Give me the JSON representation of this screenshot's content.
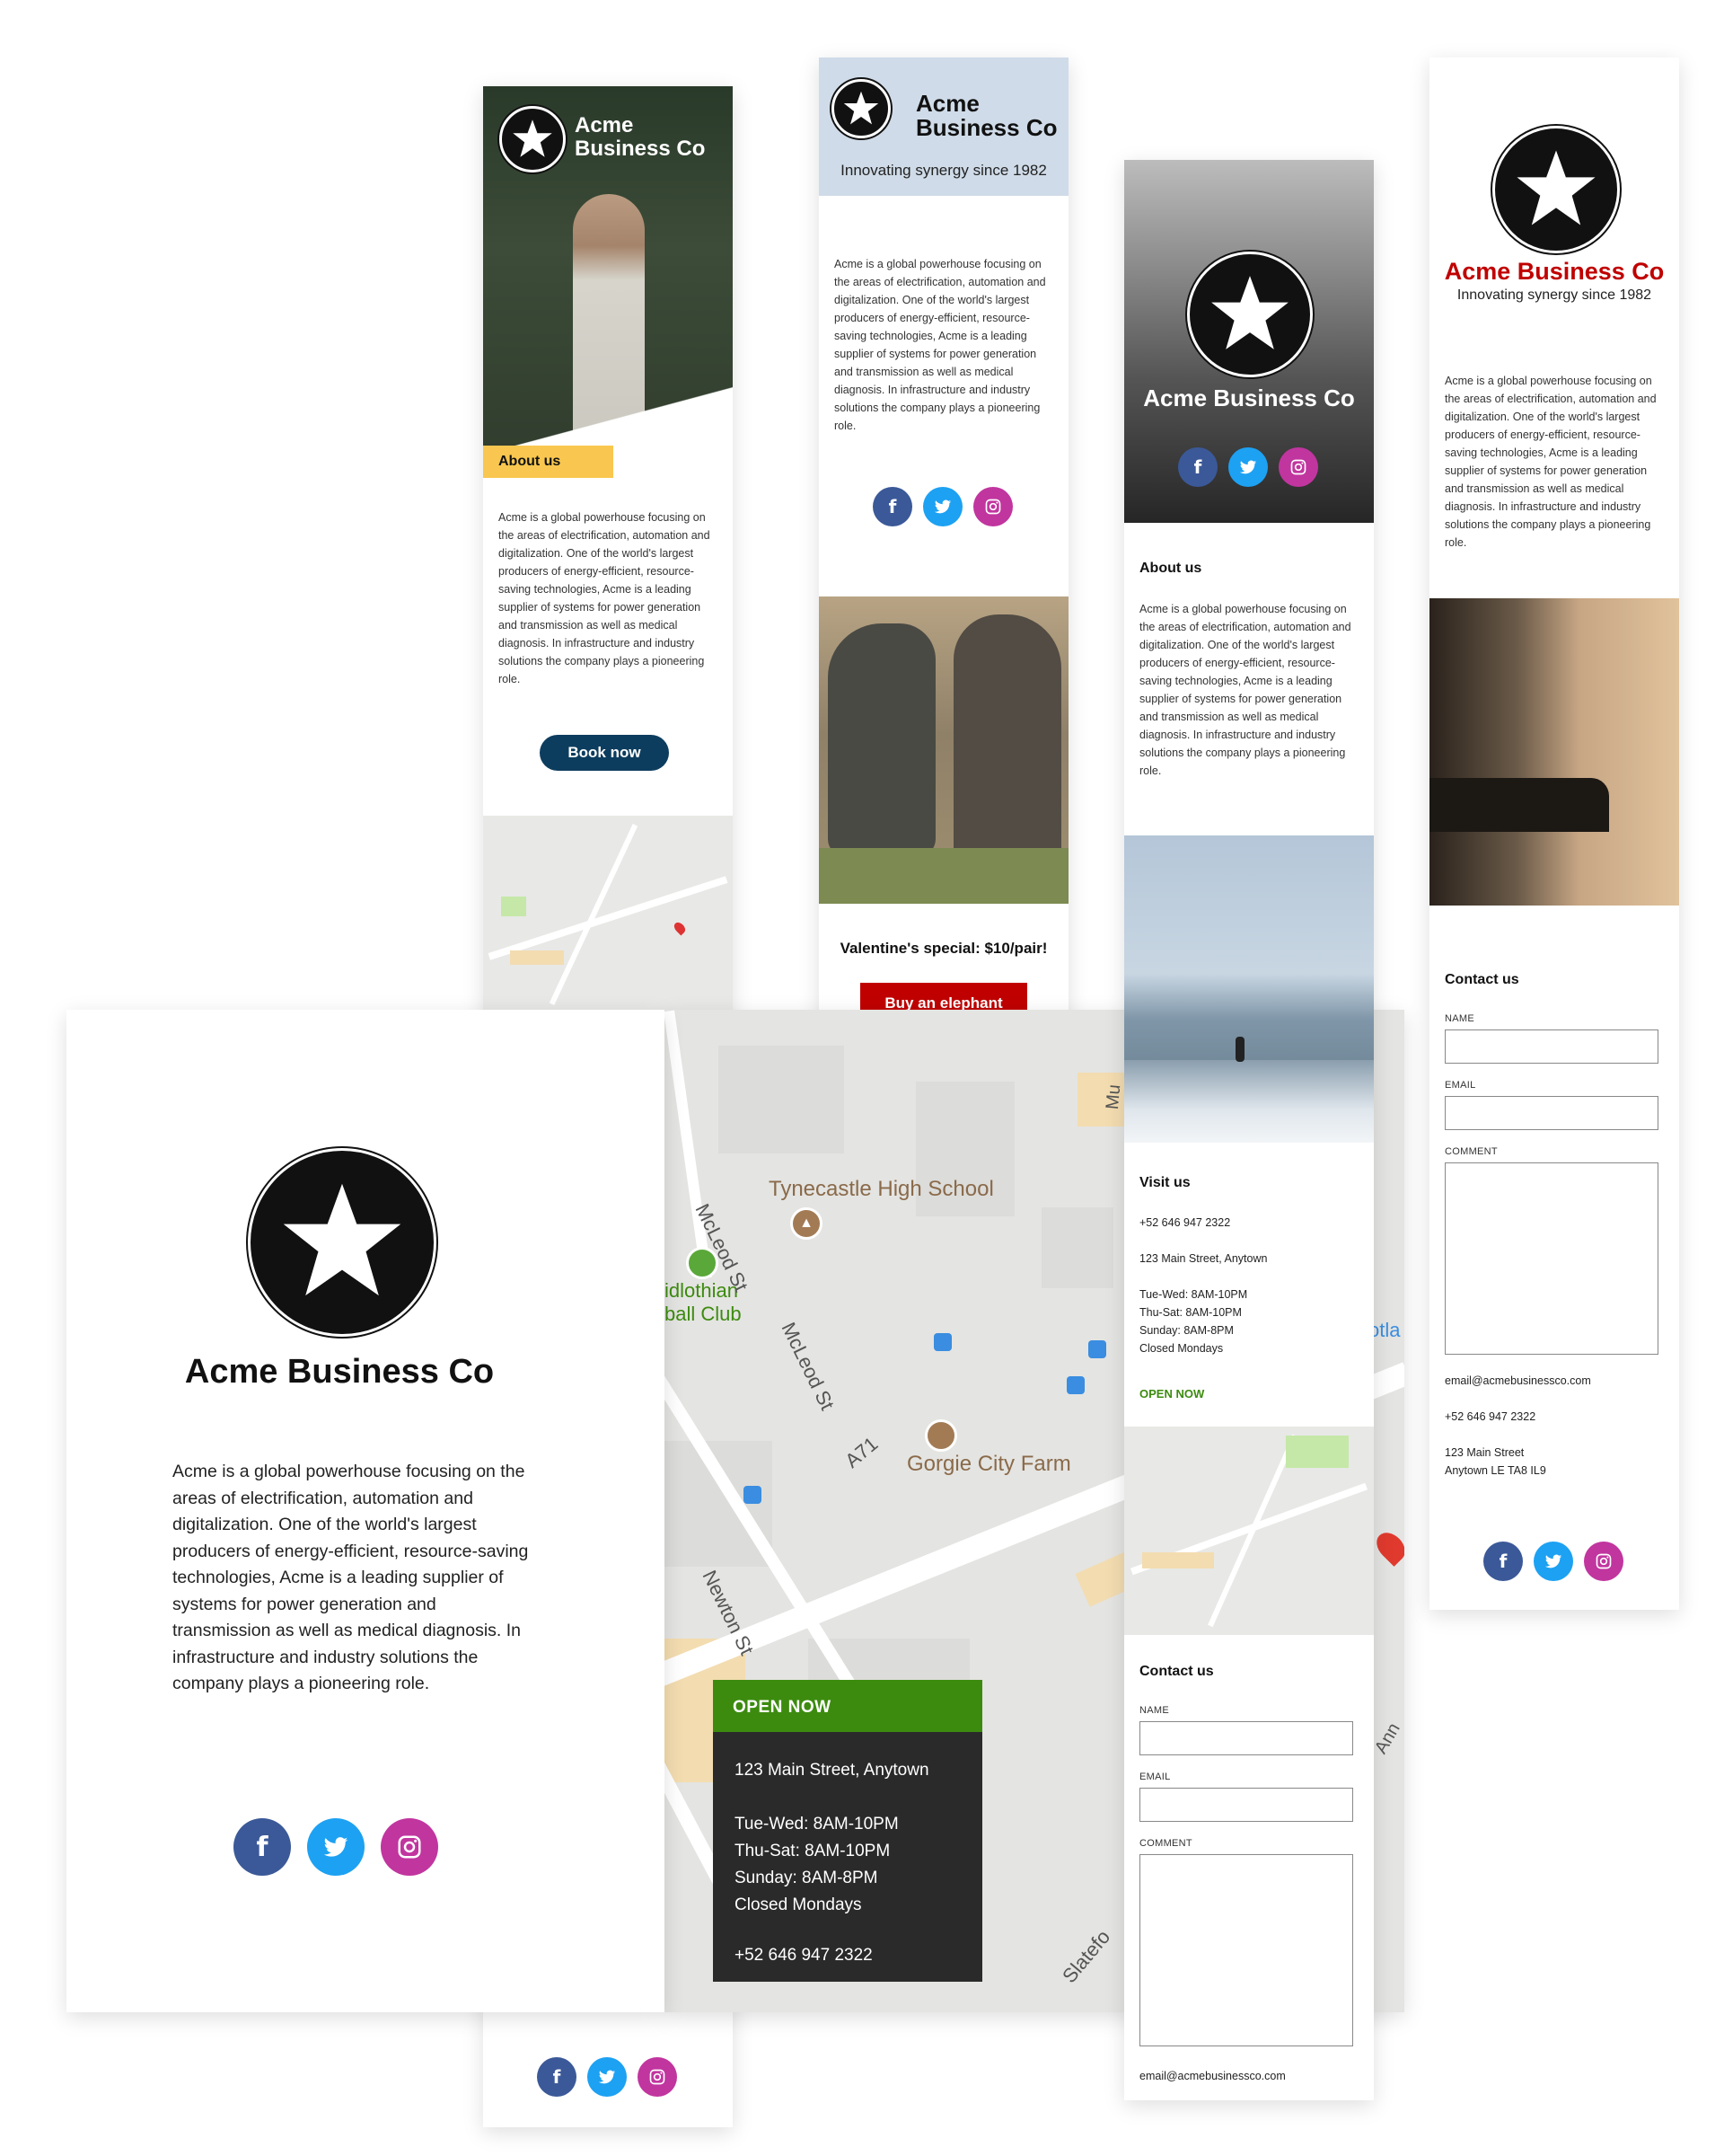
{
  "brand": {
    "name": "Acme Business Co",
    "name_line1": "Acme",
    "name_line2": "Business Co",
    "tagline": "Innovating synergy since 1982"
  },
  "about": {
    "heading": "About us",
    "text": "Acme is a global powerhouse focusing on the areas of electrification, automation and digitalization. One of the world's largest producers of energy-efficient, resource-saving technologies, Acme is a leading supplier of systems for power generation and transmission as well as medical diagnosis. In infrastructure and industry solutions the company plays a pioneering role."
  },
  "cta": {
    "book": "Book now",
    "promo": "Valentine's special: $10/pair!",
    "buy": "Buy an elephant"
  },
  "visit": {
    "heading": "Visit us",
    "phone": "+52 646 947 2322",
    "address": "123 Main Street, Anytown",
    "address_line1": "123 Main Street",
    "address_line2": "Anytown LE TA8 IL9",
    "hours": [
      "Tue-Wed: 8AM-10PM",
      "Thu-Sat: 8AM-10PM",
      "Sunday: 8AM-8PM",
      "Closed Mondays"
    ],
    "status": "OPEN NOW"
  },
  "contact": {
    "heading": "Contact us",
    "name_label": "NAME",
    "email_label": "EMAIL",
    "comment_label": "COMMENT",
    "email": "email@acmebusinessco.com"
  },
  "map": {
    "labels": {
      "school": "Tynecastle High School",
      "farm": "Gorgie City Farm",
      "club_line1": "idlothian",
      "club_line2": "ball Club",
      "street1": "McLeod St",
      "street2": "McLeod St",
      "road": "A71",
      "street3": "Newton St",
      "street4": "Slatefo",
      "street5": "Mu",
      "edge1": "otla",
      "edge2": "Ann"
    }
  },
  "social": [
    "facebook-icon",
    "twitter-icon",
    "instagram-icon"
  ],
  "colors": {
    "facebook": "#3b5998",
    "twitter": "#1da1f2",
    "instagram": "#c1359f",
    "yellow_tab": "#f9c74f",
    "book_button": "#0d3d5e",
    "buy_button": "#c00000",
    "brand_red": "#c00000",
    "open_green": "#3c8b0f",
    "hours_dark": "#2a2a2a",
    "header_blue": "#cfdbe8"
  }
}
